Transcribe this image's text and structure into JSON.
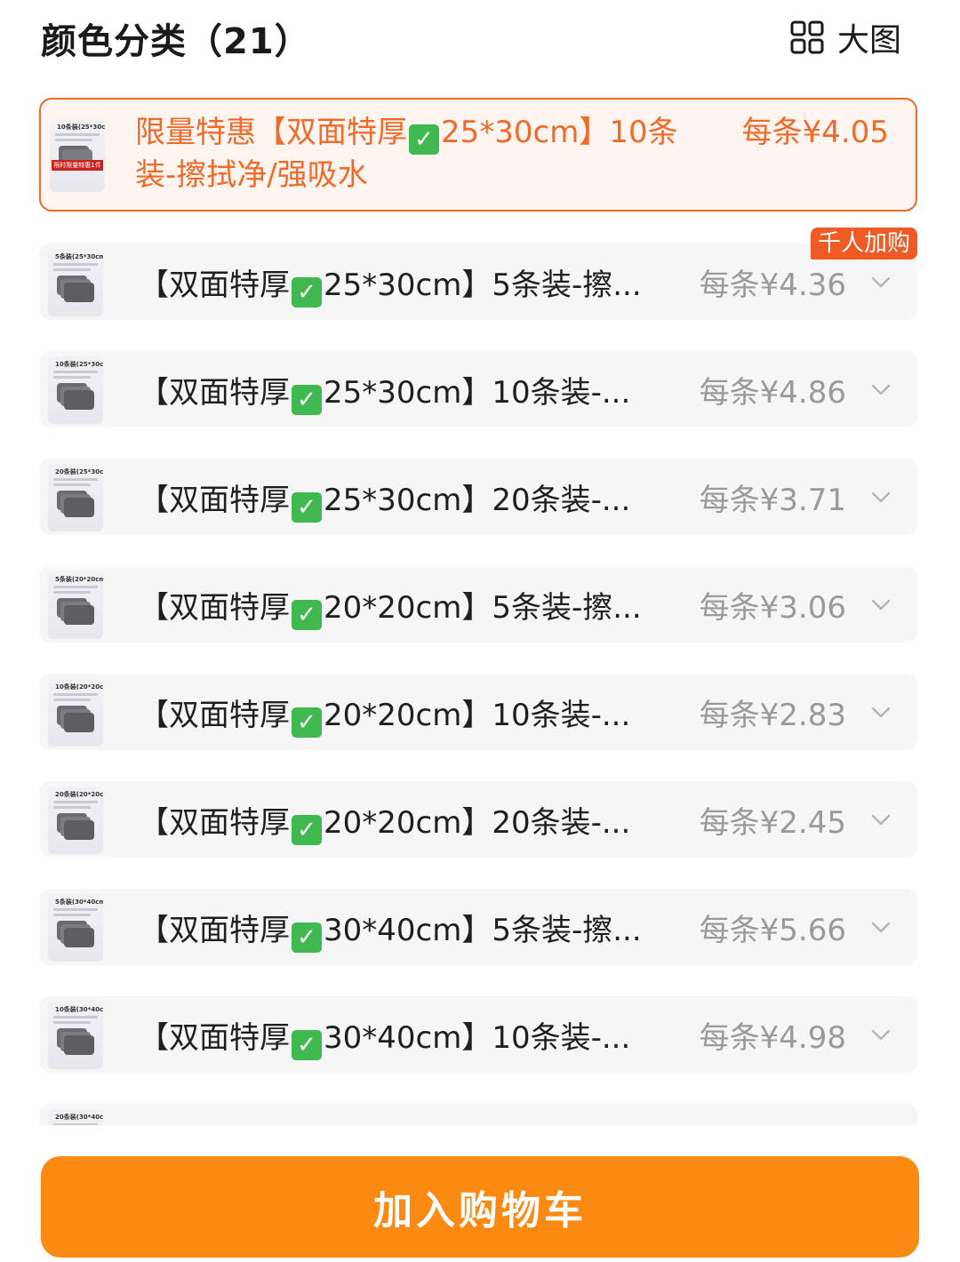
{
  "header": {
    "title": "颜色分类（21）",
    "view_toggle_label": "大图",
    "view_toggle_icon": "grid-icon"
  },
  "colors": {
    "accent": "#f06a2a",
    "button": "#fa8a12",
    "badge": "#f05a25",
    "item_bg": "#f6f6f6",
    "muted_text": "#9a9a9a"
  },
  "selected_item": {
    "name_prefix": "限量特惠【双面特厚",
    "name_suffix": "25*30cm】10条装-擦拭净/强吸水",
    "price": "每条¥4.05",
    "thumb_header": "10条装(25*30cm)",
    "thumb_banner": "限时限量特惠1件"
  },
  "badge": {
    "label": "千人加购"
  },
  "items": [
    {
      "name_prefix": "【双面特厚",
      "name_suffix": "25*30cm】5条装-擦...",
      "price": "每条¥4.36",
      "thumb_header": "5条装(25*30cm)"
    },
    {
      "name_prefix": "【双面特厚",
      "name_suffix": "25*30cm】10条装-...",
      "price": "每条¥4.86",
      "thumb_header": "10条装(25*30cm)"
    },
    {
      "name_prefix": "【双面特厚",
      "name_suffix": "25*30cm】20条装-...",
      "price": "每条¥3.71",
      "thumb_header": "20条装(25*30cm)"
    },
    {
      "name_prefix": "【双面特厚",
      "name_suffix": "20*20cm】5条装-擦...",
      "price": "每条¥3.06",
      "thumb_header": "5条装(20*20cm)"
    },
    {
      "name_prefix": "【双面特厚",
      "name_suffix": "20*20cm】10条装-...",
      "price": "每条¥2.83",
      "thumb_header": "10条装(20*20cm)"
    },
    {
      "name_prefix": "【双面特厚",
      "name_suffix": "20*20cm】20条装-...",
      "price": "每条¥2.45",
      "thumb_header": "20条装(20*20cm)"
    },
    {
      "name_prefix": "【双面特厚",
      "name_suffix": "30*40cm】5条装-擦...",
      "price": "每条¥5.66",
      "thumb_header": "5条装(30*40cm)"
    },
    {
      "name_prefix": "【双面特厚",
      "name_suffix": "30*40cm】10条装-...",
      "price": "每条¥4.98",
      "thumb_header": "10条装(30*40cm)"
    },
    {
      "name_prefix": "",
      "name_suffix": "",
      "price": "",
      "thumb_header": "20条装(30*40cm)"
    }
  ],
  "footer": {
    "add_to_cart_label": "加入购物车"
  }
}
